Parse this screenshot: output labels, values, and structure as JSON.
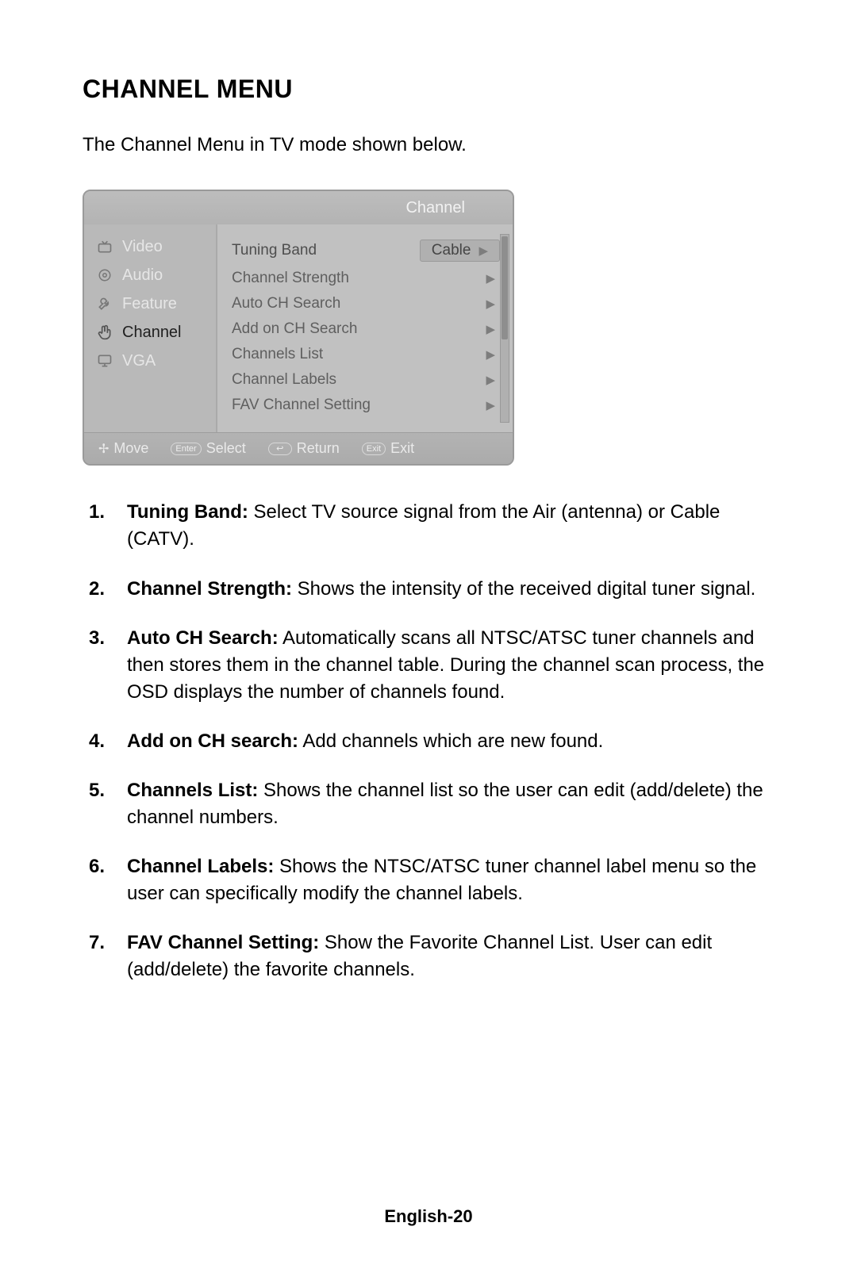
{
  "title": "CHANNEL MENU",
  "intro": "The Channel Menu in TV mode shown below.",
  "osd": {
    "header": "Channel",
    "nav": [
      {
        "label": "Video",
        "icon": "tv-icon"
      },
      {
        "label": "Audio",
        "icon": "speaker-icon"
      },
      {
        "label": "Feature",
        "icon": "wrench-icon"
      },
      {
        "label": "Channel",
        "icon": "hand-icon",
        "active": true
      },
      {
        "label": "VGA",
        "icon": "monitor-icon"
      }
    ],
    "rows": [
      {
        "label": "Tuning Band",
        "value": "Cable",
        "selected": true
      },
      {
        "label": "Channel Strength"
      },
      {
        "label": "Auto CH Search"
      },
      {
        "label": "Add on CH Search"
      },
      {
        "label": "Channels List"
      },
      {
        "label": "Channel Labels"
      },
      {
        "label": "FAV Channel Setting"
      }
    ],
    "footer": {
      "move": "Move",
      "select_key": "Enter",
      "select": "Select",
      "return": "Return",
      "exit_key": "Exit",
      "exit": "Exit"
    }
  },
  "items": [
    {
      "term": "Tuning Band:",
      "desc": " Select TV source signal from the Air (antenna) or Cable (CATV)."
    },
    {
      "term": "Channel Strength:",
      "desc": " Shows the intensity of the received digital tuner signal."
    },
    {
      "term": "Auto CH Search:",
      "desc": " Automatically scans all NTSC/ATSC tuner channels and then stores them in the channel table.  During the channel scan process, the OSD displays the number of channels found."
    },
    {
      "term": "Add on CH search:",
      "desc": " Add channels which are new found."
    },
    {
      "term": "Channels List:",
      "desc": " Shows the channel list so the user can edit (add/delete) the channel numbers."
    },
    {
      "term": "Channel Labels:",
      "desc": " Shows the NTSC/ATSC tuner channel label menu so the user can specifically modify the channel labels."
    },
    {
      "term": "FAV Channel Setting:",
      "desc": " Show the Favorite Channel List. User can edit (add/delete) the favorite channels."
    }
  ],
  "page_footer": "English-20"
}
